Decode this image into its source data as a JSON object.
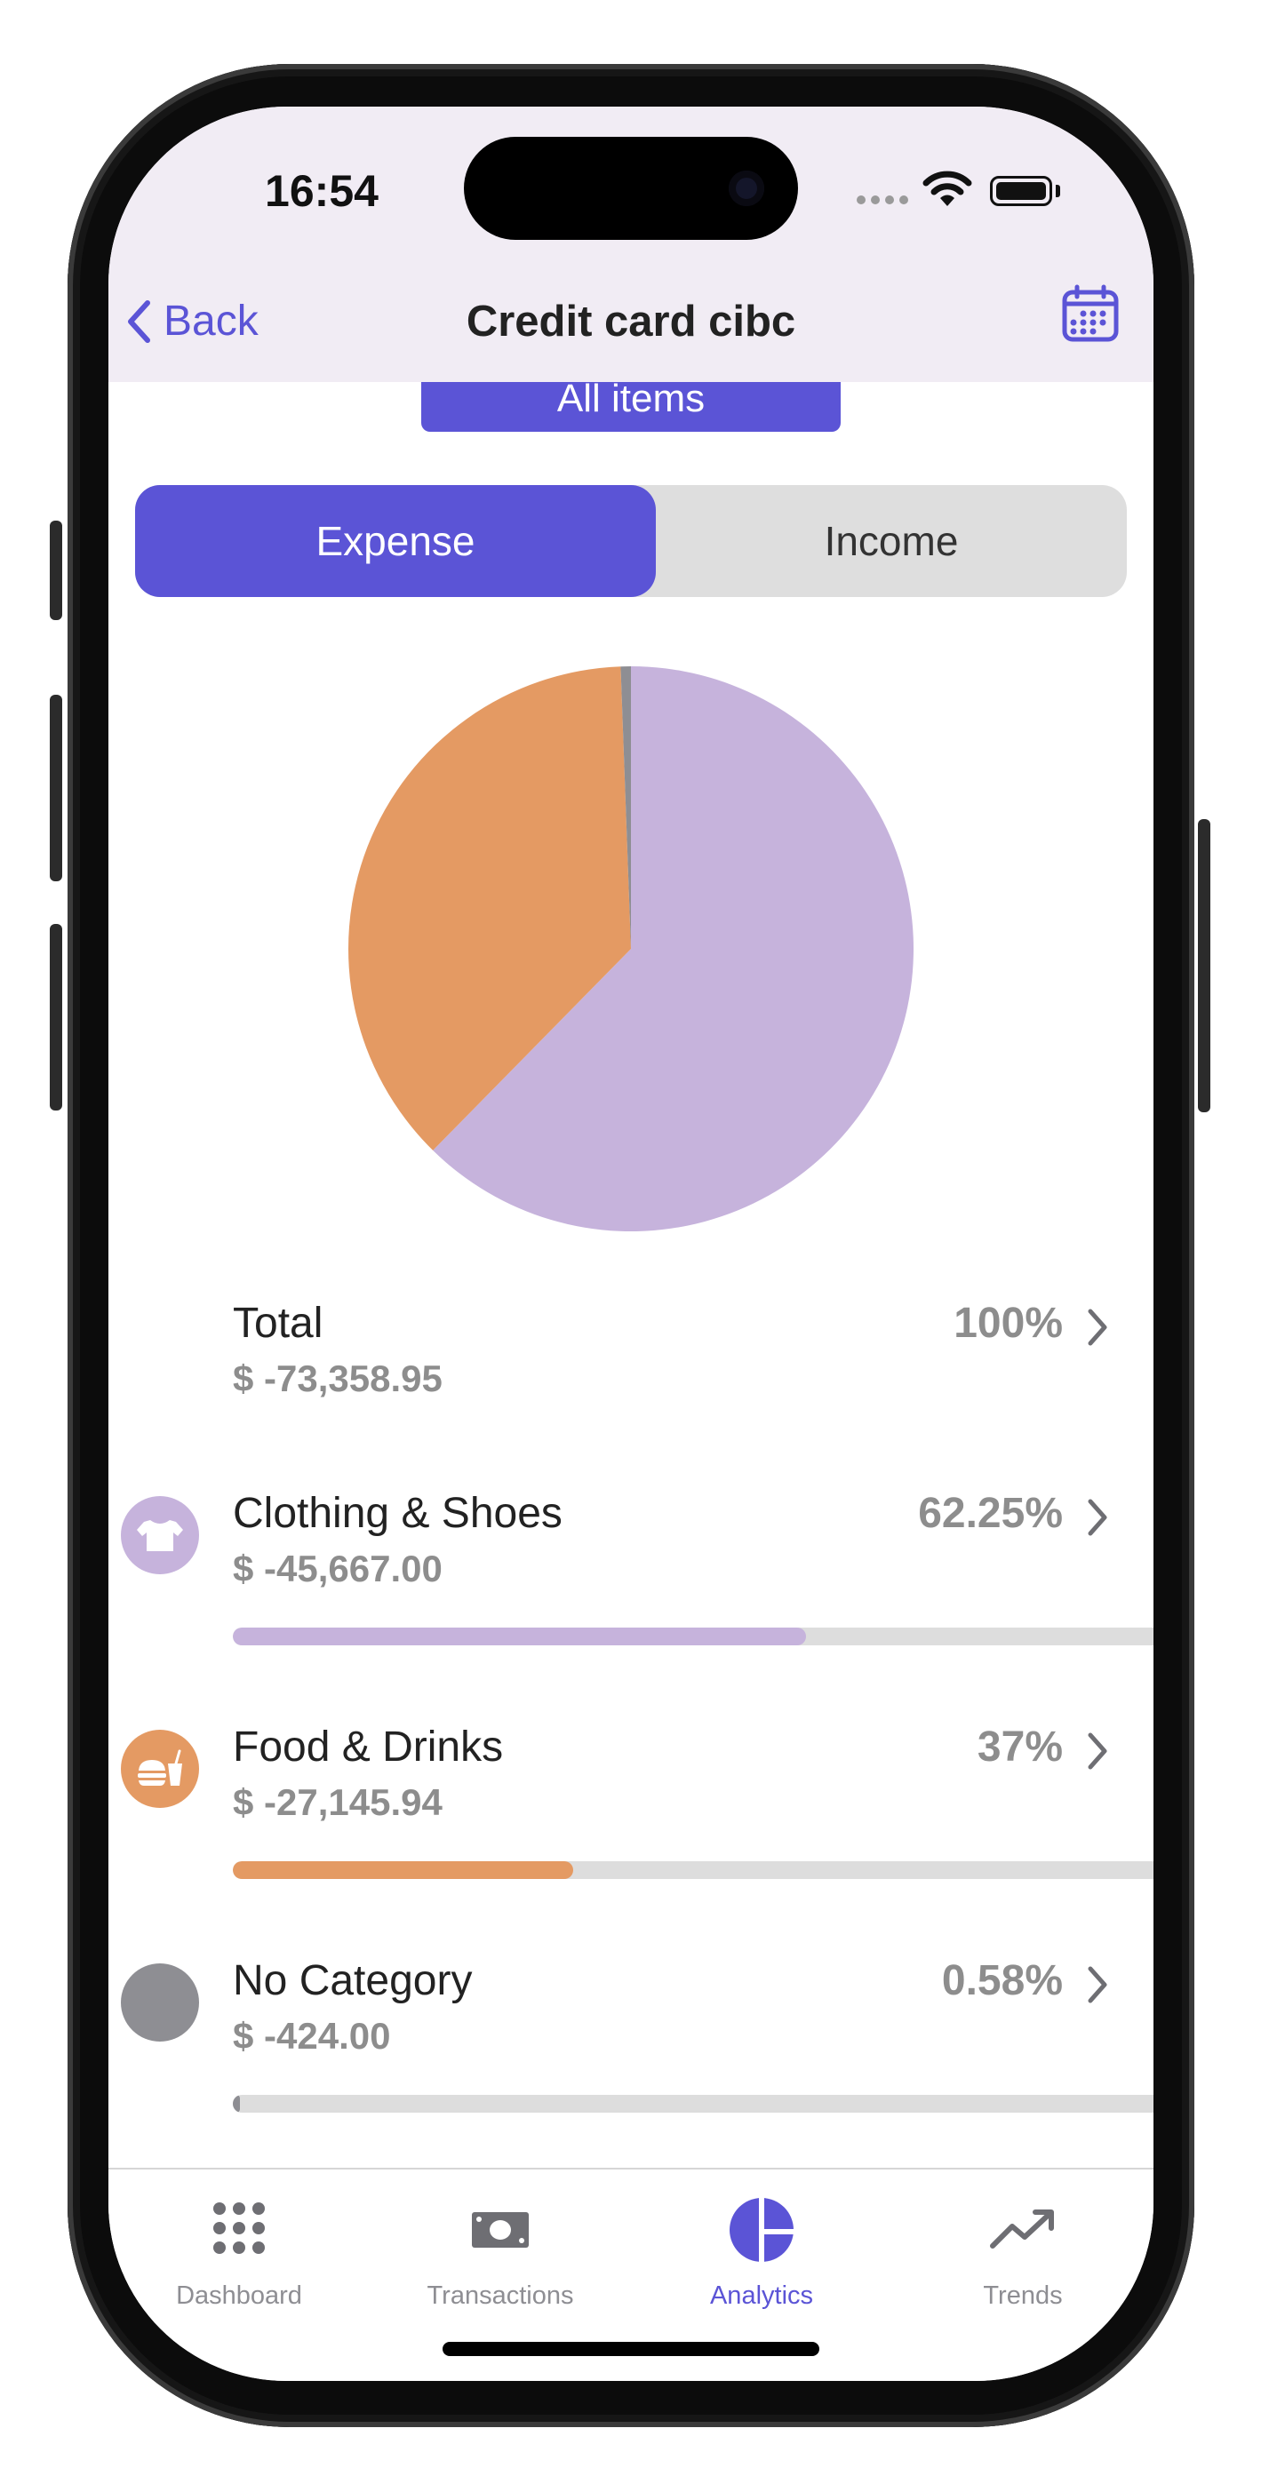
{
  "status_bar": {
    "time": "16:54"
  },
  "nav": {
    "back_label": "Back",
    "title": "Credit card cibc",
    "calendar_icon": "calendar-icon"
  },
  "filter": {
    "label": "All items"
  },
  "segment": {
    "expense": "Expense",
    "income": "Income",
    "selected": "Expense"
  },
  "colors": {
    "accent": "#5b54d6",
    "clothing": "#c6b3dc",
    "food": "#e49a63",
    "no_category": "#8e8e93",
    "header_bg": "#f1ecf4"
  },
  "chart_data": {
    "type": "pie",
    "slices": [
      {
        "label": "Clothing & Shoes",
        "value": 62.25,
        "color": "#c6b3dc"
      },
      {
        "label": "Food & Drinks",
        "value": 37.0,
        "color": "#e49a63"
      },
      {
        "label": "No Category",
        "value": 0.58,
        "color": "#8e8e93"
      }
    ]
  },
  "summary": {
    "total": {
      "name": "Total",
      "amount": "$ -73,358.95",
      "percent": "100%"
    },
    "categories": [
      {
        "name": "Clothing & Shoes",
        "amount": "$ -45,667.00",
        "percent": "62.25%",
        "fraction": 0.6225,
        "icon": "tshirt-icon"
      },
      {
        "name": "Food & Drinks",
        "amount": "$ -27,145.94",
        "percent": "37%",
        "fraction": 0.37,
        "icon": "fast-food-icon"
      },
      {
        "name": "No Category",
        "amount": "$ -424.00",
        "percent": "0.58%",
        "fraction": 0.0058,
        "icon": "circle-icon"
      }
    ]
  },
  "tabbar": {
    "items": [
      {
        "label": "Dashboard",
        "icon": "grid-dots-icon"
      },
      {
        "label": "Transactions",
        "icon": "banknote-icon"
      },
      {
        "label": "Analytics",
        "icon": "pie-chart-icon"
      },
      {
        "label": "Trends",
        "icon": "trend-up-icon"
      }
    ],
    "active": "Analytics"
  }
}
